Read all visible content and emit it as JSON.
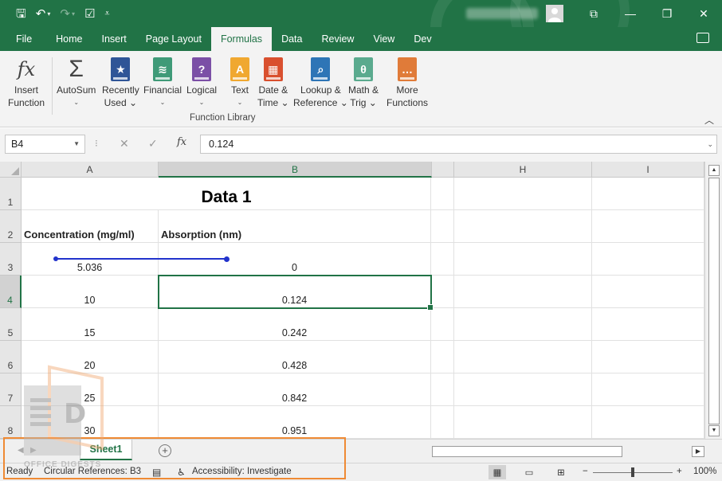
{
  "qat": {
    "save_icon": "autosave-icon",
    "undo_icon": "undo-icon",
    "redo_icon": "redo-icon",
    "customize_icon": "customize-qat-icon"
  },
  "tabs": [
    "File",
    "Home",
    "Insert",
    "Page Layout",
    "Formulas",
    "Data",
    "Review",
    "View",
    "Dev"
  ],
  "active_tab": "Formulas",
  "ribbon": {
    "group_label": "Function Library",
    "buttons": [
      {
        "line1": "Insert",
        "line2": "Function"
      },
      {
        "line1": "AutoSum",
        "line2": "⌄"
      },
      {
        "line1": "Recently",
        "line2": "Used ⌄"
      },
      {
        "line1": "Financial",
        "line2": "⌄"
      },
      {
        "line1": "Logical",
        "line2": "⌄"
      },
      {
        "line1": "Text",
        "line2": "⌄"
      },
      {
        "line1": "Date &",
        "line2": "Time ⌄"
      },
      {
        "line1": "Lookup &",
        "line2": "Reference ⌄"
      },
      {
        "line1": "Math &",
        "line2": "Trig ⌄"
      },
      {
        "line1": "More",
        "line2": "Functions"
      }
    ]
  },
  "formula_bar": {
    "name_box": "B4",
    "formula": "0.124",
    "fx_label": "fx"
  },
  "columns": [
    "A",
    "B",
    "H",
    "I"
  ],
  "rows": [
    "1",
    "2",
    "3",
    "4",
    "5",
    "6",
    "7",
    "8"
  ],
  "sheet": {
    "title": "Data 1",
    "header_a": "Concentration (mg/ml)",
    "header_b": "Absorption (nm)",
    "data": [
      {
        "a": "5.036",
        "b": "0"
      },
      {
        "a": "10",
        "b": "0.124"
      },
      {
        "a": "15",
        "b": "0.242"
      },
      {
        "a": "20",
        "b": "0.428"
      },
      {
        "a": "25",
        "b": "0.842"
      },
      {
        "a": "30",
        "b": "0.951"
      }
    ]
  },
  "sheet_tab": "Sheet1",
  "status": {
    "ready": "Ready",
    "circular": "Circular References: B3",
    "accessibility": "Accessibility: Investigate",
    "zoom": "100%"
  },
  "watermark": {
    "text": "OFFICE DIGESTS"
  },
  "colors": {
    "accent": "#217346",
    "tracer": "#2233cc",
    "highlight": "#ef8a34"
  }
}
